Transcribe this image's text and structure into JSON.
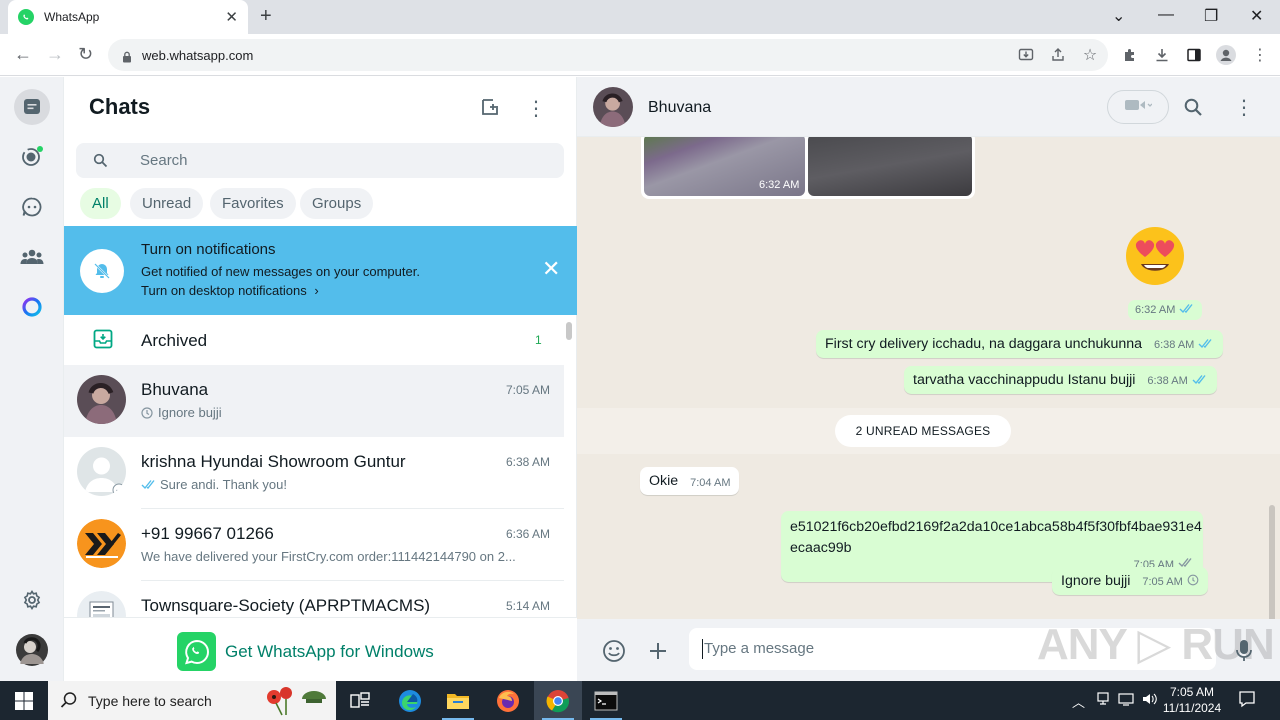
{
  "browser": {
    "tab_title": "WhatsApp",
    "url": "web.whatsapp.com",
    "new_tab": "+"
  },
  "sidebar": {
    "title": "Chats",
    "search_placeholder": "Search",
    "filters": [
      "All",
      "Unread",
      "Favorites",
      "Groups"
    ],
    "active_filter": "All",
    "notification": {
      "title": "Turn on notifications",
      "text": "Get notified of new messages on your computer.",
      "link": "Turn on desktop notifications"
    },
    "archived": {
      "label": "Archived",
      "count": "1"
    },
    "chats": [
      {
        "name": "Bhuvana",
        "time": "7:05 AM",
        "preview": "Ignore bujji",
        "selected": true
      },
      {
        "name": "krishna Hyundai Showroom Guntur",
        "time": "6:38 AM",
        "preview": "Sure andi. Thank you!"
      },
      {
        "name": "+91 99667 01266",
        "time": "6:36 AM",
        "preview": "We have delivered your FirstCry.com order:111442144790 on 2..."
      },
      {
        "name": "Townsquare-Society (APRPTMACMS)",
        "time": "5:14 AM",
        "preview": ""
      }
    ],
    "footer": "Get WhatsApp for Windows"
  },
  "conversation": {
    "contact_name": "Bhuvana",
    "photo_time": "6:32 AM",
    "emoji": "😍",
    "emoji_time": "6:32 AM",
    "messages_out_1": [
      {
        "text": "First cry delivery icchadu, na daggara unchukunna",
        "time": "6:38 AM"
      },
      {
        "text": "tarvatha vacchinappudu Istanu bujji",
        "time": "6:38 AM"
      }
    ],
    "unread_label": "2 UNREAD MESSAGES",
    "incoming": {
      "text": "Okie",
      "time": "7:04 AM"
    },
    "hash_message": {
      "line1": "e51021f6cb20efbd2169f2a2da10ce1abca58b4f5f30fbf4bae931e4",
      "line2": "ecaac99b",
      "time": "7:05 AM"
    },
    "last_message": {
      "text": "Ignore bujji",
      "time": "7:05 AM"
    },
    "input_placeholder": "Type a message",
    "watermark": "ANY ▷ RUN"
  },
  "taskbar": {
    "search_placeholder": "Type here to search",
    "time": "7:05 AM",
    "date": "11/11/2024"
  },
  "colors": {
    "accent": "#25d366",
    "notification_bg": "#53bdeb",
    "outgoing_bubble": "#d9fdd3",
    "read_tick": "#53bdeb"
  }
}
